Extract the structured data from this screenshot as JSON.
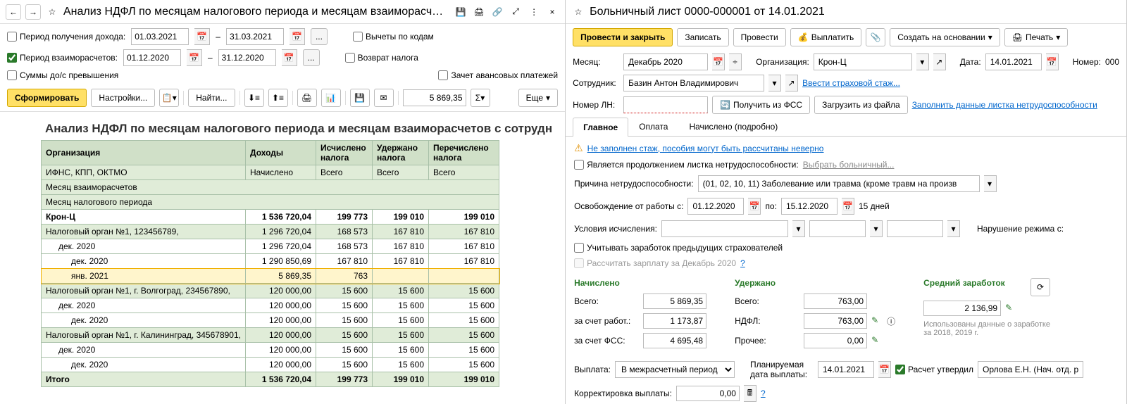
{
  "left": {
    "title": "Анализ НДФЛ по месяцам налогового периода и месяцам взаиморасч…",
    "filters": {
      "period_income_label": "Период получения дохода:",
      "income_from": "01.03.2021",
      "income_to": "31.03.2021",
      "dash": "–",
      "period_settle_label": "Период взаиморасчетов:",
      "settle_from": "01.12.2020",
      "settle_to": "31.12.2020",
      "sums_excess_label": "Суммы до/с превышения",
      "deduct_codes_label": "Вычеты по кодам",
      "tax_return_label": "Возврат налога",
      "advance_offset_label": "Зачет авансовых платежей"
    },
    "toolbar": {
      "form": "Сформировать",
      "settings": "Настройки...",
      "find": "Найти...",
      "amount": "5 869,35",
      "more": "Еще"
    },
    "report": {
      "title": "Анализ НДФЛ по месяцам налогового периода и месяцам взаиморасчетов с сотрудн",
      "headers": {
        "org": "Организация",
        "income": "Доходы",
        "calc_tax": "Исчислено налога",
        "withheld_tax": "Удержано налога",
        "transferred_tax": "Перечислено налога",
        "ifns": "ИФНС, КПП, ОКТМО",
        "accrued": "Начислено",
        "total": "Всего",
        "month_settle": "Месяц взаиморасчетов",
        "month_tax": "Месяц налогового периода"
      },
      "rows": [
        {
          "label": "Крон-Ц",
          "v": [
            "1 536 720,04",
            "199 773",
            "199 010",
            "199 010"
          ],
          "cls": "org"
        },
        {
          "label": "Налоговый орган №1, 123456789,",
          "v": [
            "1 296 720,04",
            "168 573",
            "167 810",
            "167 810"
          ],
          "cls": "hdr2"
        },
        {
          "label": "дек. 2020",
          "v": [
            "1 296 720,04",
            "168 573",
            "167 810",
            "167 810"
          ],
          "indent": 1
        },
        {
          "label": "дек. 2020",
          "v": [
            "1 290 850,69",
            "167 810",
            "167 810",
            "167 810"
          ],
          "indent": 2
        },
        {
          "label": "янв. 2021",
          "v": [
            "5 869,35",
            "763",
            "",
            ""
          ],
          "indent": 2,
          "cls": "hl"
        },
        {
          "label": "Налоговый орган №1, г. Волгоград, 234567890,",
          "v": [
            "120 000,00",
            "15 600",
            "15 600",
            "15 600"
          ],
          "cls": "hdr2"
        },
        {
          "label": "дек. 2020",
          "v": [
            "120 000,00",
            "15 600",
            "15 600",
            "15 600"
          ],
          "indent": 1
        },
        {
          "label": "дек. 2020",
          "v": [
            "120 000,00",
            "15 600",
            "15 600",
            "15 600"
          ],
          "indent": 2
        },
        {
          "label": "Налоговый орган №1, г. Калининград, 345678901,",
          "v": [
            "120 000,00",
            "15 600",
            "15 600",
            "15 600"
          ],
          "cls": "hdr2"
        },
        {
          "label": "дек. 2020",
          "v": [
            "120 000,00",
            "15 600",
            "15 600",
            "15 600"
          ],
          "indent": 1
        },
        {
          "label": "дек. 2020",
          "v": [
            "120 000,00",
            "15 600",
            "15 600",
            "15 600"
          ],
          "indent": 2
        }
      ],
      "total_label": "Итого",
      "totals": [
        "1 536 720,04",
        "199 773",
        "199 010",
        "199 010"
      ]
    }
  },
  "right": {
    "title": "Больничный лист 0000-000001 от 14.01.2021",
    "toolbar": {
      "post_close": "Провести и закрыть",
      "save": "Записать",
      "post": "Провести",
      "pay": "Выплатить",
      "create_based": "Создать на основании",
      "print": "Печать"
    },
    "header": {
      "month_lbl": "Месяц:",
      "month": "Декабрь 2020",
      "org_lbl": "Организация:",
      "org": "Крон-Ц",
      "date_lbl": "Дата:",
      "date": "14.01.2021",
      "number_lbl": "Номер:",
      "number": "000",
      "emp_lbl": "Сотрудник:",
      "emp": "Базин Антон Владимирович",
      "ins_link": "Ввести страховой стаж...",
      "ln_lbl": "Номер ЛН:",
      "fss_btn": "Получить из ФСС",
      "load_btn": "Загрузить из файла",
      "fill_link": "Заполнить данные листка нетрудоспособности"
    },
    "tabs": [
      "Главное",
      "Оплата",
      "Начислено (подробно)"
    ],
    "main": {
      "warn": "Не заполнен стаж, пособия могут быть рассчитаны неверно",
      "continuation_lbl": "Является продолжением листка нетрудоспособности:",
      "choose_sick": "Выбрать больничный...",
      "reason_lbl": "Причина нетрудоспособности:",
      "reason": "(01, 02, 10, 11) Заболевание или травма (кроме травм на произв",
      "relief_lbl": "Освобождение от работы с:",
      "relief_from": "01.12.2020",
      "relief_to_lbl": "по:",
      "relief_to": "15.12.2020",
      "days": "15 дней",
      "cond_lbl": "Условия исчисления:",
      "violation_lbl": "Нарушение режима с:",
      "prev_ins_lbl": "Учитывать заработок предыдущих страхователей",
      "calc_salary_lbl": "Рассчитать зарплату за Декабрь 2020",
      "accrued_hdr": "Начислено",
      "withheld_hdr": "Удержано",
      "avg_hdr": "Средний заработок",
      "total_lbl": "Всего:",
      "employer_lbl": "за счет работ.:",
      "fss_lbl": "за счет ФСС:",
      "ndfl_lbl": "НДФЛ:",
      "other_lbl": "Прочее:",
      "accrued_total": "5 869,35",
      "accrued_emp": "1 173,87",
      "accrued_fss": "4 695,48",
      "withheld_total": "763,00",
      "withheld_ndfl": "763,00",
      "withheld_other": "0,00",
      "avg": "2 136,99",
      "info": "Использованы данные о заработке за 2018,   2019 г.",
      "payment_lbl": "Выплата:",
      "payment": "В межрасчетный период",
      "plan_date_lbl": "Планируемая дата выплаты:",
      "plan_date": "14.01.2021",
      "approved_lbl": "Расчет утвердил",
      "approved_by": "Орлова Е.Н. (Нач. отд. расч",
      "corr_lbl": "Корректировка выплаты:",
      "corr": "0,00"
    }
  }
}
